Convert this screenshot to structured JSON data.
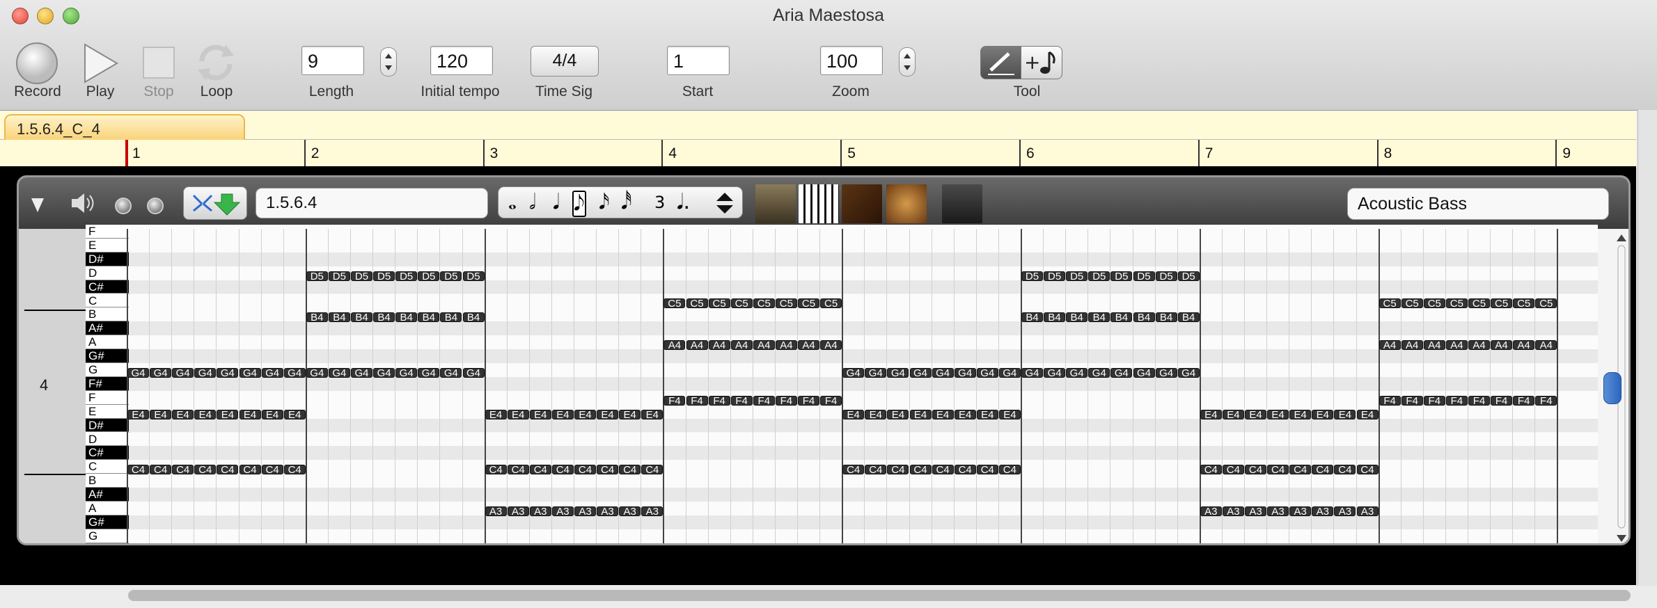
{
  "window": {
    "title": "Aria Maestosa"
  },
  "toolbar": {
    "record_label": "Record",
    "play_label": "Play",
    "stop_label": "Stop",
    "loop_label": "Loop",
    "length_value": "9",
    "length_label": "Length",
    "tempo_value": "120",
    "tempo_label": "Initial tempo",
    "timesig_value": "4/4",
    "timesig_label": "Time Sig",
    "start_value": "1",
    "start_label": "Start",
    "zoom_value": "100",
    "zoom_label": "Zoom",
    "tool_label": "Tool"
  },
  "sequence_tab": "1.5.6.4_C_4",
  "ruler": {
    "measures": [
      "1",
      "2",
      "3",
      "4",
      "5",
      "6",
      "7",
      "8",
      "9"
    ]
  },
  "track": {
    "name": "1.5.6.4",
    "instrument": "Acoustic Bass",
    "octave_label": "4",
    "duration_icons": [
      "whole-note-icon",
      "half-note-icon",
      "quarter-note-icon",
      "eighth-note-icon",
      "sixteenth-note-icon",
      "thirty-second-note-icon",
      "triplet-icon",
      "dotted-note-icon"
    ],
    "editor_icons": [
      "score-editor-icon",
      "keyboard-editor-icon",
      "guitar-editor-icon",
      "drum-editor-icon",
      "controller-editor-icon"
    ],
    "piano_keys": [
      "F",
      "E",
      "D#",
      "D",
      "C#",
      "C",
      "B",
      "A#",
      "A",
      "G#",
      "G",
      "F#",
      "F",
      "E",
      "D#",
      "D",
      "C#",
      "C",
      "B",
      "A#",
      "A",
      "G#",
      "G"
    ],
    "notes": [
      {
        "label": "G4",
        "measure": 1
      },
      {
        "label": "E4",
        "measure": 1
      },
      {
        "label": "C4",
        "measure": 1
      },
      {
        "label": "D5",
        "measure": 2
      },
      {
        "label": "B4",
        "measure": 2
      },
      {
        "label": "G4",
        "measure": 2
      },
      {
        "label": "E4",
        "measure": 3
      },
      {
        "label": "C4",
        "measure": 3
      },
      {
        "label": "A3",
        "measure": 3
      },
      {
        "label": "C5",
        "measure": 4
      },
      {
        "label": "A4",
        "measure": 4
      },
      {
        "label": "F4",
        "measure": 4
      },
      {
        "label": "G4",
        "measure": 5
      },
      {
        "label": "E4",
        "measure": 5
      },
      {
        "label": "C4",
        "measure": 5
      },
      {
        "label": "D5",
        "measure": 6
      },
      {
        "label": "B4",
        "measure": 6
      },
      {
        "label": "G4",
        "measure": 6
      },
      {
        "label": "E4",
        "measure": 7
      },
      {
        "label": "C4",
        "measure": 7
      },
      {
        "label": "A3",
        "measure": 7
      },
      {
        "label": "C5",
        "measure": 8
      },
      {
        "label": "A4",
        "measure": 8
      },
      {
        "label": "F4",
        "measure": 8
      }
    ]
  },
  "colors": {
    "tab_fill": "#f9d278",
    "tab_border": "#efb64c",
    "ruler_bg": "#fffbd8",
    "scroll_thumb": "#2c66c0",
    "playhead": "#cc0000"
  }
}
